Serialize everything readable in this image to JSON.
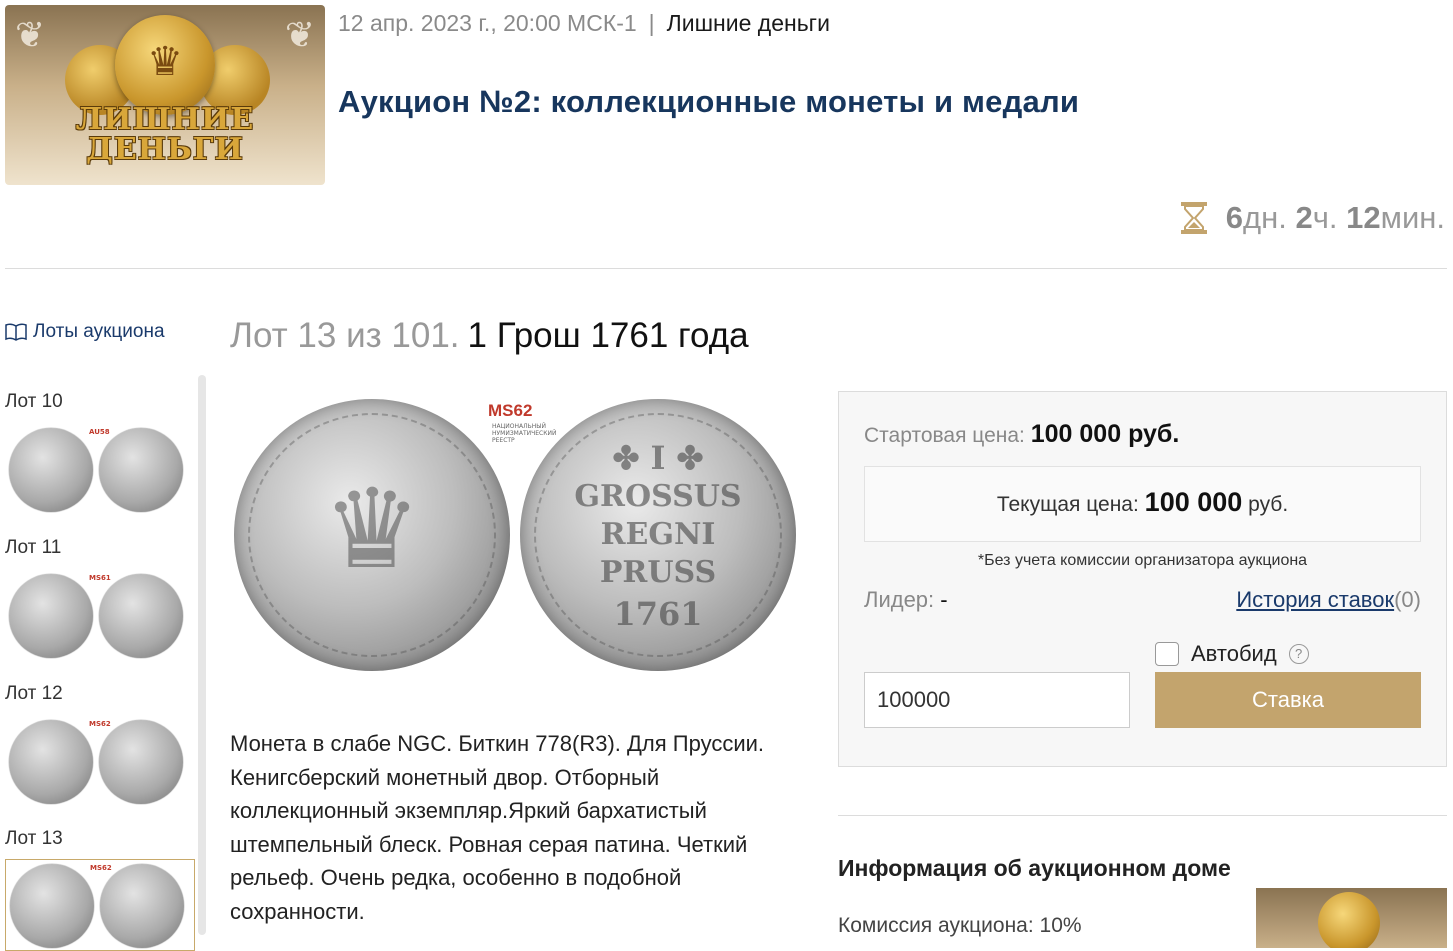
{
  "header": {
    "logo_text": "ЛИШНИЕ ДЕНЬГИ",
    "date": "12 апр. 2023 г., 20:00 МСК-1",
    "separator": "|",
    "auction_house": "Лишние деньги",
    "title": "Аукцион №2: коллекционные монеты и медали",
    "timer": {
      "days": "6",
      "days_unit": "дн.",
      "hours": "2",
      "hours_unit": "ч.",
      "minutes": "12",
      "minutes_unit": "мин."
    }
  },
  "sidebar": {
    "lots_link": "Лоты аукциона",
    "lots": [
      {
        "label": "Лот 10",
        "grade": "AU58"
      },
      {
        "label": "Лот 11",
        "grade": "MS61"
      },
      {
        "label": "Лот 12",
        "grade": "MS62"
      },
      {
        "label": "Лот 13",
        "grade": "MS62"
      }
    ]
  },
  "lot": {
    "number_text": "Лот 13 из 101.",
    "name": "1 Грош 1761 года",
    "grade": "MS62",
    "grade_note": "НАЦИОНАЛЬНЫЙ НУМИЗМАТИЧЕСКИЙ РЕЕСТР",
    "description": "Монета в слабе NGC. Биткин 778(R3). Для Пруссии. Кенигсберский монетный двор. Отборный коллекционный экземпляр.Яркий бархатистый штемпельный блеск. Ровная серая патина. Четкий рельеф. Очень редка, особенно в подобной сохранности."
  },
  "bid": {
    "start_label": "Стартовая цена:",
    "start_value": "100 000 руб.",
    "current_label": "Текущая цена:",
    "current_value": "100 000",
    "current_unit": "руб.",
    "note": "*Без учета комиссии организатора аукциона",
    "leader_label": "Лидер:",
    "leader_value": "-",
    "history_link": "История ставок",
    "history_count": "(0)",
    "autobid_label": "Автобид",
    "help_symbol": "?",
    "input_value": "100000",
    "button_label": "Ставка"
  },
  "info": {
    "title": "Информация об аукционном доме",
    "commission": "Комиссия аукциона: 10%"
  },
  "colors": {
    "accent": "#c3a46d",
    "link": "#1a3a6b",
    "title": "#17365d",
    "grade": "#c0392b"
  }
}
